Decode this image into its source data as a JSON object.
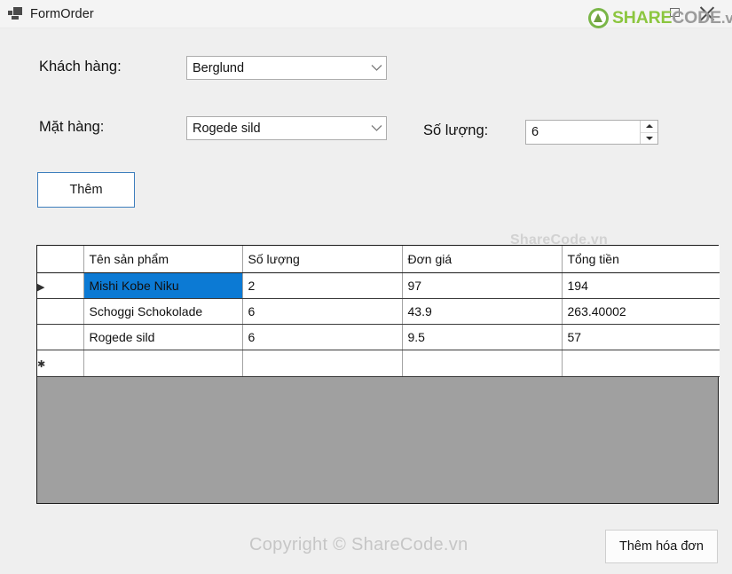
{
  "window": {
    "title": "FormOrder",
    "icon": "form-icon",
    "controls": {
      "maximize": "maximize-icon",
      "close": "close-icon"
    }
  },
  "brand": {
    "share": "SHARE",
    "code": "CODE",
    "vn": ".vn",
    "green": "#8CC63F",
    "gray": "#9B9B9B"
  },
  "form": {
    "customer": {
      "label": "Khách hàng:",
      "value": "Berglund"
    },
    "product": {
      "label": "Mặt hàng:",
      "value": "Rogede sild"
    },
    "quantity": {
      "label": "Số lượng:",
      "value": "6"
    },
    "add_button": "Thêm"
  },
  "grid": {
    "watermark": "ShareCode.vn",
    "columns": [
      "",
      "Tên sản phẩm",
      "Số lượng",
      "Đơn giá",
      "Tổng tiền"
    ],
    "selected_row_index": 0,
    "accent": "#0C7AD4",
    "rows": [
      {
        "marker": "▶",
        "name": "Mishi Kobe Niku",
        "quantity": "2",
        "price": "97",
        "total": "194"
      },
      {
        "marker": "",
        "name": "Schoggi Schokolade",
        "quantity": "6",
        "price": "43.9",
        "total": "263.40002"
      },
      {
        "marker": "",
        "name": "Rogede sild",
        "quantity": "6",
        "price": "9.5",
        "total": "57"
      },
      {
        "marker": "✱",
        "name": "",
        "quantity": "",
        "price": "",
        "total": ""
      }
    ]
  },
  "footer": {
    "copyright": "Copyright © ShareCode.vn",
    "invoice_button": "Thêm hóa đơn"
  }
}
